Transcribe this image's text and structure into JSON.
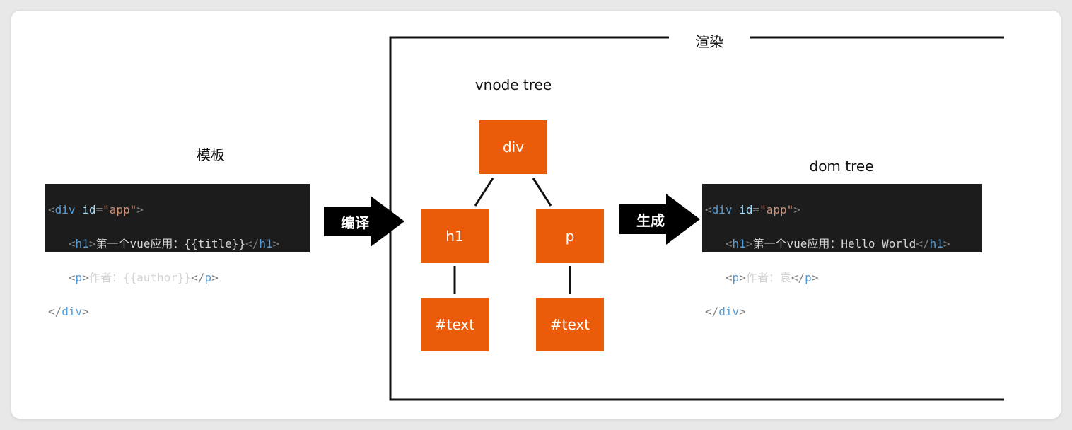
{
  "labels": {
    "template_title": "模板",
    "render_title": "渲染",
    "vnode_title": "vnode tree",
    "dom_title": "dom tree",
    "compile_arrow": "编译",
    "generate_arrow": "生成"
  },
  "template_code": {
    "l1_tag": "div",
    "l1_attr": "id",
    "l1_val": "\"app\"",
    "l2_tag": "h1",
    "l2_text": "第一个vue应用：{{title}}",
    "l3_tag": "p",
    "l3_text": "作者：{{author}}",
    "l4_tag": "div"
  },
  "dom_code": {
    "l1_tag": "div",
    "l1_attr": "id",
    "l1_val": "\"app\"",
    "l2_tag": "h1",
    "l2_text": "第一个vue应用：Hello World",
    "l3_tag": "p",
    "l3_text": "作者：袁",
    "l4_tag": "div"
  },
  "vnodes": {
    "root": "div",
    "left": "h1",
    "right": "p",
    "left_text": "#text",
    "right_text": "#text"
  },
  "colors": {
    "node": "#ea5c0a",
    "code_bg": "#1c1c1c",
    "tag": "#569cd6",
    "attr": "#9cdcfe",
    "string": "#ce9178"
  }
}
